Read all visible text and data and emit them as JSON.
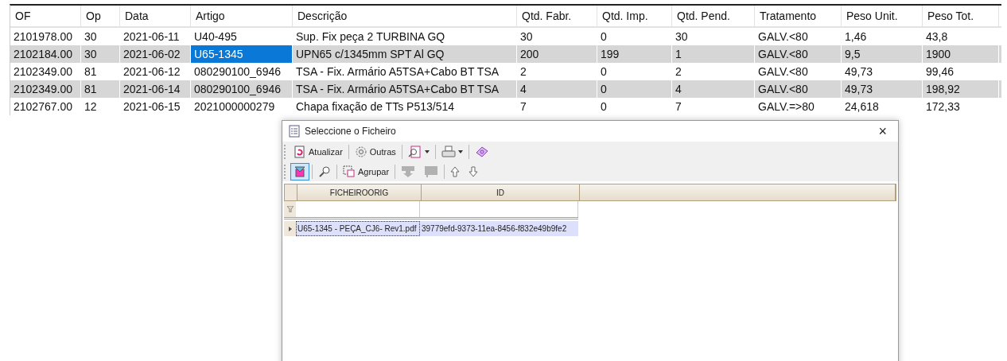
{
  "table": {
    "columns": [
      "OF",
      "Op",
      "Data",
      "Artigo",
      "Descrição",
      "Qtd. Fabr.",
      "Qtd. Imp.",
      "Qtd. Pend.",
      "Tratamento",
      "Peso Unit.",
      "Peso Tot."
    ],
    "rows": [
      {
        "selected": false,
        "current": false,
        "cells": [
          "2101978.00",
          "30",
          "2021-06-11",
          "U40-495",
          "Sup. Fix peça 2 TURBINA GQ",
          "30",
          "0",
          "30",
          "GALV.<80",
          "1,46",
          "43,8"
        ]
      },
      {
        "selected": true,
        "current": true,
        "cells": [
          "2102184.00",
          "30",
          "2021-06-02",
          "U65-1345",
          "UPN65 c/1345mm SPT Al GQ",
          "200",
          "199",
          "1",
          "GALV.<80",
          "9,5",
          "1900"
        ]
      },
      {
        "selected": false,
        "current": false,
        "cells": [
          "2102349.00",
          "81",
          "2021-06-12",
          "080290100_6946",
          "TSA - Fix. Armário A5TSA+Cabo BT TSA",
          "2",
          "0",
          "2",
          "GALV.<80",
          "49,73",
          "99,46"
        ]
      },
      {
        "selected": true,
        "current": false,
        "cells": [
          "2102349.00",
          "81",
          "2021-06-14",
          "080290100_6946",
          "TSA - Fix. Armário A5TSA+Cabo BT TSA",
          "4",
          "0",
          "4",
          "GALV.<80",
          "49,73",
          "198,92"
        ]
      },
      {
        "selected": false,
        "current": false,
        "cells": [
          "2102767.00",
          "12",
          "2021-06-15",
          "2021000000279",
          "Chapa fixação de TTs P513/514",
          "7",
          "0",
          "7",
          "GALV.=>80",
          "24,618",
          "172,33"
        ]
      }
    ]
  },
  "dialog": {
    "title": "Seleccione o Ficheiro",
    "close": "×",
    "toolbar_1": [
      {
        "kind": "refresh",
        "label": "Atualizar",
        "dropdown": false
      },
      {
        "kind": "gear",
        "label": "Outras",
        "dropdown": false
      },
      {
        "kind": "preview",
        "dropdown": true
      },
      {
        "kind": "print",
        "dropdown": true
      },
      {
        "kind": "help",
        "dropdown": false
      }
    ],
    "toolbar_2": [
      {
        "kind": "toggle",
        "pressed": true,
        "disabled": false
      },
      {
        "kind": "search",
        "pressed": false,
        "disabled": false
      },
      {
        "kind": "group",
        "label": "Agrupar",
        "pressed": false,
        "disabled": false
      },
      {
        "kind": "down-block",
        "pressed": false,
        "disabled": true
      },
      {
        "kind": "block",
        "pressed": false,
        "disabled": true
      },
      {
        "kind": "up",
        "pressed": false,
        "disabled": false
      },
      {
        "kind": "down",
        "pressed": false,
        "disabled": false
      }
    ],
    "grid": {
      "columns": [
        "FICHEIROORIG",
        "ID"
      ],
      "rows": [
        {
          "selected": true,
          "cells": [
            "U65-1345 - PEÇA_CJ6- Rev1.pdf",
            "39779efd-9373-11ea-8456-f832e49b9fe2"
          ]
        }
      ]
    }
  }
}
